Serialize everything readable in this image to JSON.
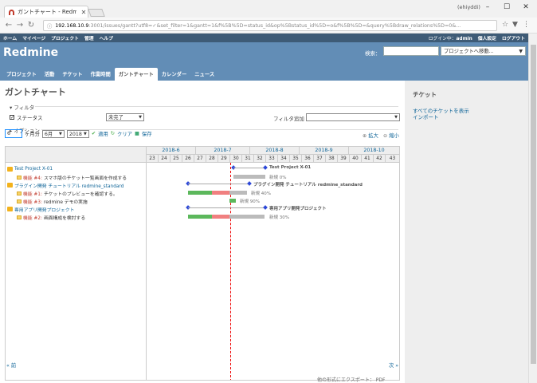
{
  "browser": {
    "tab_title": "ガントチャート - Redmine",
    "user_tag": "(ehiyddi)",
    "url_host": "192.168.10.9",
    "url_path": ":3001/issues/gantt?utf8=✓&set_filter=1&gantt=1&f%5B%5D=status_id&op%5Bstatus_id%5D=o&f%5B%5D=&query%5Bdraw_relations%5D=0&..."
  },
  "topmenu": {
    "left": [
      "ホーム",
      "マイページ",
      "プロジェクト",
      "管理",
      "ヘルプ"
    ],
    "login_label": "ログイン中：",
    "login_user": "admin",
    "account": "個人設定",
    "logout": "ログアウト"
  },
  "header": {
    "title": "Redmine",
    "search_label": "検索：",
    "jump_placeholder": "プロジェクトへ移動..."
  },
  "main_menu": [
    "プロジェクト",
    "活動",
    "チケット",
    "作業時間",
    "ガントチャート",
    "カレンダー",
    "ニュース"
  ],
  "page_title": "ガントチャート",
  "filters": {
    "legend": "フィルタ",
    "status_label": "ステータス",
    "status_op": "未完了",
    "add_filter_label": "フィルタ追加",
    "options_legend": "オプション"
  },
  "controls": {
    "months": "6",
    "months_label": "ヶ月分",
    "month_value": "6月",
    "year_value": "2018",
    "apply": "適用",
    "clear": "クリア",
    "save": "保存",
    "zoom_in": "拡大",
    "zoom_out": "縮小"
  },
  "gantt": {
    "months": [
      "2018-6",
      "2018-7",
      "2018-8",
      "2018-9",
      "2018-10"
    ],
    "weeks": [
      "23",
      "24",
      "25",
      "26",
      "27",
      "28",
      "29",
      "30",
      "31",
      "32",
      "33",
      "34",
      "35",
      "36",
      "37",
      "38",
      "39",
      "40",
      "41",
      "42",
      "43"
    ],
    "rows": [
      {
        "type": "project",
        "name": "Test Project X-01"
      },
      {
        "type": "issue",
        "tracker": "機能 #4:",
        "subject": "スマホ版のチケット一覧画面を作成する"
      },
      {
        "type": "project",
        "name": "プラグイン開発 チュートリアル redmine_standard"
      },
      {
        "type": "issue",
        "tracker": "機能 #1:",
        "subject": "チケットのプレビューを確認する。"
      },
      {
        "type": "issue",
        "tracker": "機能 #3:",
        "subject": "redmine デモの実施"
      },
      {
        "type": "project",
        "name": "専用アプリ開発プロジェクト"
      },
      {
        "type": "issue",
        "tracker": "機能 #2:",
        "subject": "画面構成を検討する"
      }
    ],
    "labels": {
      "p1": "Test Project X-01",
      "i4": "新規 0%",
      "p2": "プラグイン開発 チュートリアル redmine_standard",
      "i1": "新規 40%",
      "i3": "新規 90%",
      "p3": "専用アプリ開発プロジェクト",
      "i2": "新規 30%"
    }
  },
  "pagination": {
    "prev": "« 前",
    "next": "次 »"
  },
  "export_text": "他の形式にエクスポート： PDF",
  "sidebar": {
    "title": "チケット",
    "links": [
      "すべてのチケットを表示",
      "インポート"
    ]
  }
}
